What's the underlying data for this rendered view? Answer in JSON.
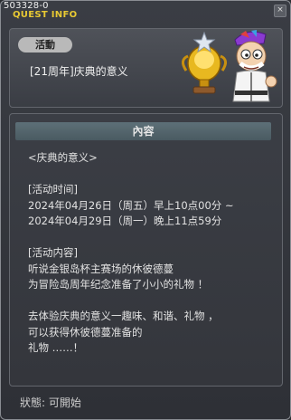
{
  "window": {
    "quest_id": "503328-0",
    "title": "QUEST INFO",
    "close_symbol": "×"
  },
  "quest": {
    "category": "活動",
    "name": "[21周年]庆典的意义"
  },
  "npc": {
    "icon": "npc-with-golden-trophy"
  },
  "content": {
    "header": "內容",
    "lines": [
      "<庆典的意义>",
      "",
      "[活动时间]",
      "2024年04月26日（周五）早上10点00分 ~",
      "2024年04月29日（周一）晚上11点59分",
      "",
      "[活动内容]",
      "听说金银岛杯主赛场的休彼德蔓",
      "为冒险岛周年纪念准备了小小的礼物 ！",
      "",
      "去体验庆典的意义一趣味、和谐、礼物 ，",
      "可以获得休彼德蔓准备的",
      "礼物 ……！"
    ]
  },
  "status": {
    "text": "狀態:  可開始"
  },
  "colors": {
    "title": "#e8c933",
    "badge": "#b9b9b9",
    "header": "#5d7078"
  }
}
